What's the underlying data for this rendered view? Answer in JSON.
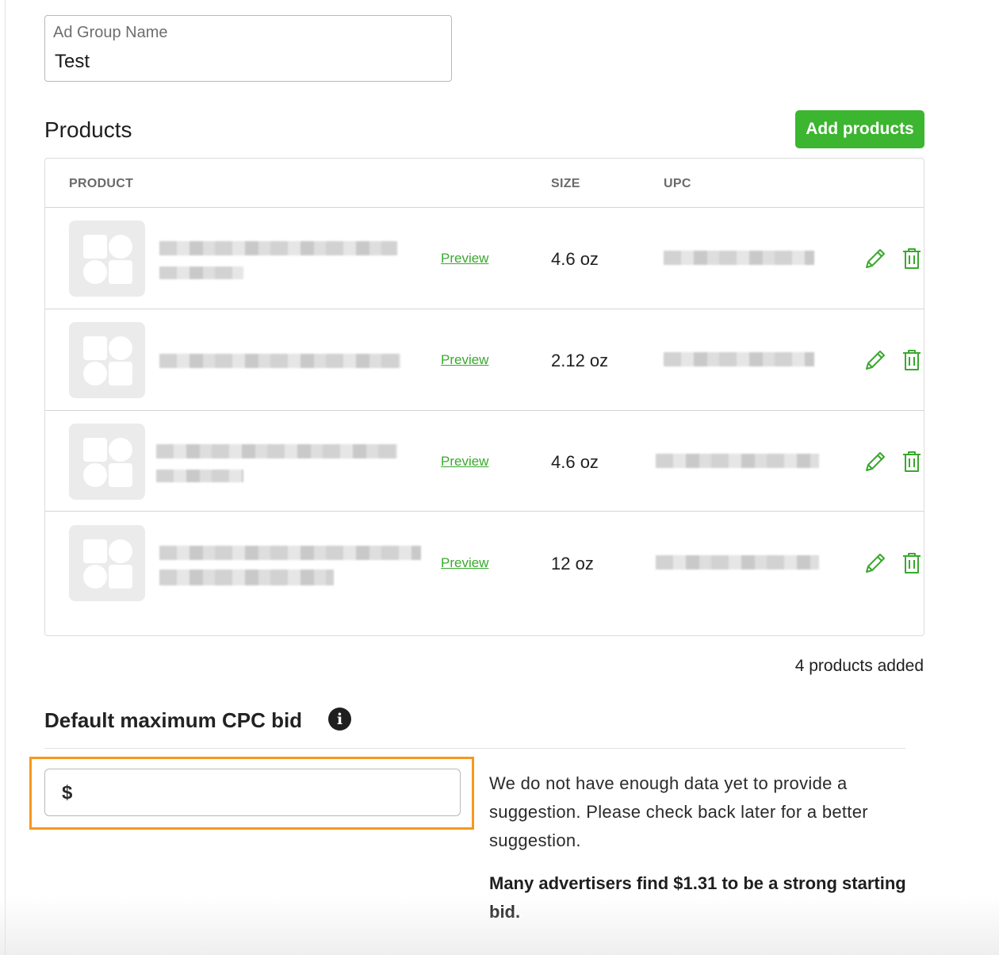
{
  "ad_group": {
    "label": "Ad Group Name",
    "value": "Test"
  },
  "products_section": {
    "title": "Products",
    "add_button": "Add products",
    "columns": {
      "product": "PRODUCT",
      "size": "SIZE",
      "upc": "UPC"
    },
    "rows": [
      {
        "preview": "Preview",
        "size": "4.6 oz"
      },
      {
        "preview": "Preview",
        "size": "2.12 oz"
      },
      {
        "preview": "Preview",
        "size": "4.6 oz"
      },
      {
        "preview": "Preview",
        "size": "12 oz"
      }
    ],
    "count_text": "4 products added"
  },
  "cpc": {
    "title": "Default maximum CPC bid",
    "info_icon": "i",
    "currency": "$",
    "input_value": "",
    "hint": "We do not have enough data yet to provide a suggestion. Please check back later for a better suggestion.",
    "hint_strong": "Many advertisers find $1.31 to be a strong starting bid."
  },
  "colors": {
    "accent": "#3cb530",
    "highlight": "#f7981d",
    "link": "#3aa82f"
  },
  "icons": [
    "image-placeholder-icon",
    "pencil-icon",
    "trash-icon",
    "info-icon"
  ]
}
